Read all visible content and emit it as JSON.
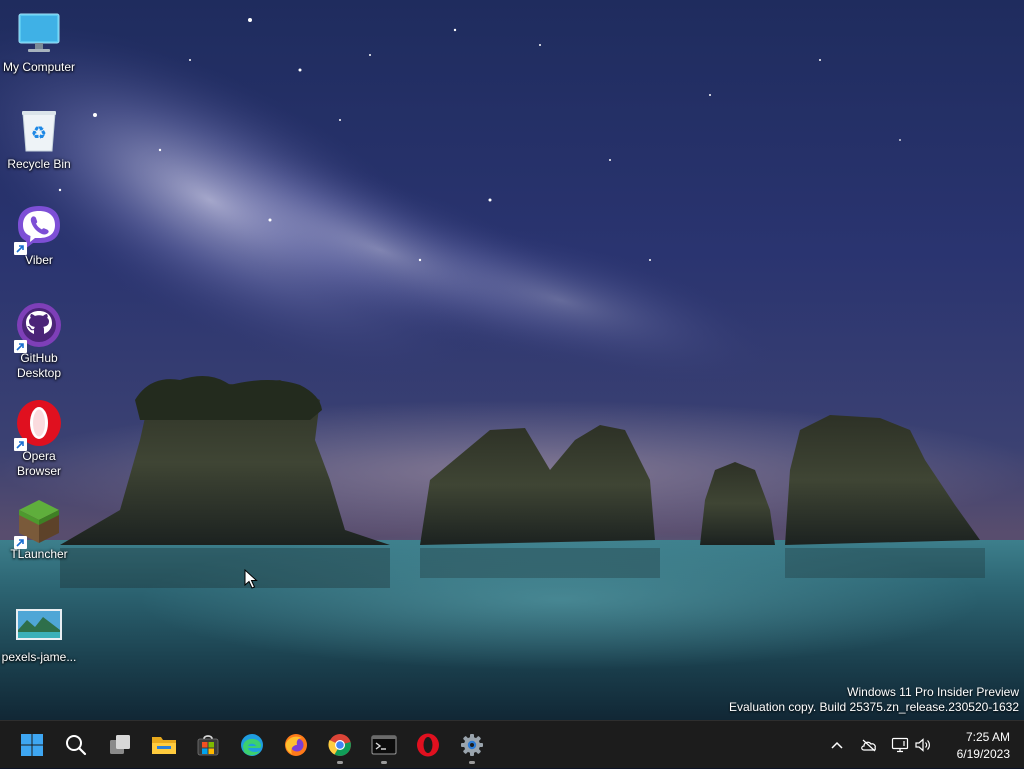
{
  "desktop": {
    "icons": [
      {
        "label": "My Computer",
        "icon": "monitor-icon",
        "shortcut": false
      },
      {
        "label": "Recycle Bin",
        "icon": "recycle-bin-icon",
        "shortcut": false
      },
      {
        "label": "Viber",
        "icon": "viber-icon",
        "shortcut": true
      },
      {
        "label": "GitHub\nDesktop",
        "icon": "github-icon",
        "shortcut": true
      },
      {
        "label": "Opera\nBrowser",
        "icon": "opera-icon",
        "shortcut": true
      },
      {
        "label": "TLauncher",
        "icon": "minecraft-block-icon",
        "shortcut": true
      },
      {
        "label": "pexels-jame...",
        "icon": "image-file-icon",
        "shortcut": false
      }
    ]
  },
  "watermark": {
    "line1": "Windows 11 Pro Insider Preview",
    "line2": "Evaluation copy. Build 25375.zn_release.230520-1632"
  },
  "taskbar": {
    "apps": [
      {
        "name": "Start",
        "icon": "windows-start-icon",
        "running": false
      },
      {
        "name": "Search",
        "icon": "search-icon",
        "running": false
      },
      {
        "name": "Task View",
        "icon": "task-view-icon",
        "running": false
      },
      {
        "name": "File Explorer",
        "icon": "folder-icon",
        "running": false
      },
      {
        "name": "Microsoft Store",
        "icon": "store-icon",
        "running": false
      },
      {
        "name": "Microsoft Edge",
        "icon": "edge-icon",
        "running": false
      },
      {
        "name": "Firefox",
        "icon": "firefox-icon",
        "running": false
      },
      {
        "name": "Google Chrome",
        "icon": "chrome-icon",
        "running": true
      },
      {
        "name": "Terminal",
        "icon": "terminal-icon",
        "running": true
      },
      {
        "name": "Opera",
        "icon": "opera-icon",
        "running": false
      },
      {
        "name": "Settings",
        "icon": "settings-gear-icon",
        "running": true
      }
    ],
    "tray": {
      "icons": [
        "chevron-up-icon",
        "cloud-offline-icon",
        "network-icon",
        "speaker-icon"
      ],
      "time": "7:25 AM",
      "date": "6/19/2023"
    }
  },
  "colors": {
    "taskbar_bg": "#1c1c1c",
    "accent": "#0078d4"
  }
}
